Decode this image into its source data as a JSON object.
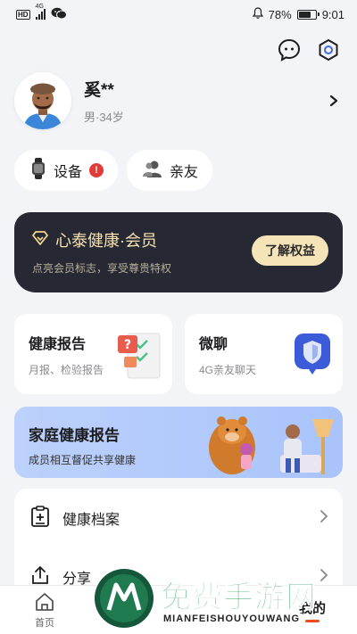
{
  "status_bar": {
    "network_badge": "HD",
    "signal_label": "4G",
    "battery_percent": 78,
    "battery_text": "78%",
    "time": "9:01"
  },
  "header": {
    "icons": [
      "chat-bubble-icon",
      "settings-hexagon-icon"
    ]
  },
  "profile": {
    "name": "奚**",
    "meta": "男·34岁"
  },
  "pills": {
    "devices_label": "设备",
    "devices_alert": "!",
    "family_label": "亲友"
  },
  "member": {
    "title": "心泰健康·会员",
    "subtitle": "点亮会员标志，享受尊贵特权",
    "button": "了解权益",
    "colors": {
      "bg": "#262833",
      "gold": "#f6e4b9"
    }
  },
  "cards": {
    "report_title": "健康报告",
    "report_sub": "月报、检验报告",
    "chat_title": "微聊",
    "chat_sub": "4G亲友聊天"
  },
  "family_report": {
    "title": "家庭健康报告",
    "subtitle": "成员相互督促共享健康"
  },
  "list": {
    "items": [
      {
        "label": "健康档案",
        "icon": "clipboard-plus-icon"
      },
      {
        "label": "分享",
        "icon": "share-icon"
      }
    ]
  },
  "bottom_nav": {
    "home": "首页",
    "mine": "我的",
    "accent": "#e94f1e"
  },
  "watermark": {
    "title": "免费手游网",
    "subtitle": "MIANFEISHOUYOUWANG"
  }
}
